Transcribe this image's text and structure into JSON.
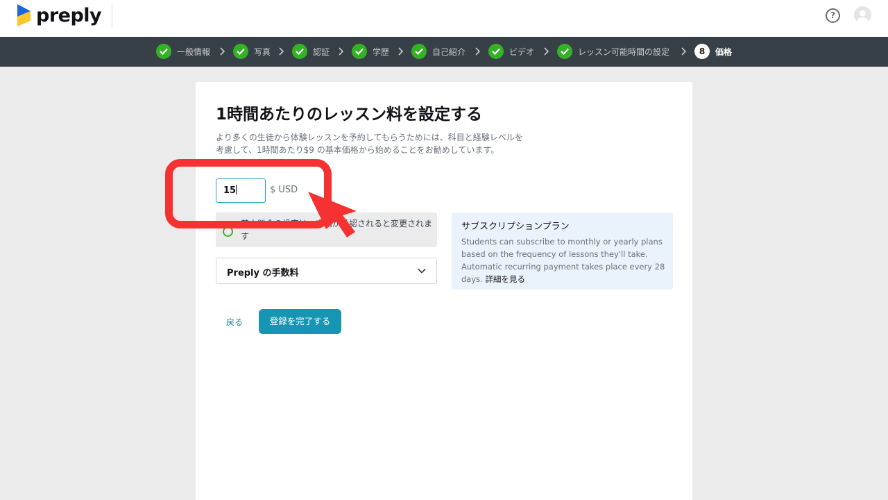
{
  "header": {
    "brand": "preply",
    "help_icon": "?"
  },
  "steps": [
    {
      "label": "一般情報",
      "status": "done"
    },
    {
      "label": "写真",
      "status": "done"
    },
    {
      "label": "認証",
      "status": "done"
    },
    {
      "label": "学歴",
      "status": "done"
    },
    {
      "label": "自己紹介",
      "status": "done"
    },
    {
      "label": "ビデオ",
      "status": "done"
    },
    {
      "label": "レッスン可能時間の設定",
      "status": "done"
    },
    {
      "label": "価格",
      "status": "current",
      "number": "8"
    }
  ],
  "pricing": {
    "title": "1時間あたりのレッスン料を設定する",
    "description": "より多くの生徒から体験レッスンを予約してもらうためには、科目と経験レベルを考慮して、1時間あたり$9 の基本価格から始めることをお勧めしています。",
    "price_value": "15",
    "currency": "$ USD",
    "note": "基本料金の設定は、申請が承認されると変更されます",
    "fee_dropdown_label": "Preply の手数料",
    "subscription": {
      "title": "サブスクリプションプラン",
      "text": "Students can subscribe to monthly or yearly plans based on the frequency of lessons they'll take. Automatic recurring payment takes place every 28 days.",
      "link": "詳細を見る"
    },
    "back_label": "戻る",
    "submit_label": "登録を完了する"
  },
  "colors": {
    "accent": "#1796b4",
    "check": "#35b126",
    "steps_bar": "#384047",
    "annotation": "#f53131"
  }
}
